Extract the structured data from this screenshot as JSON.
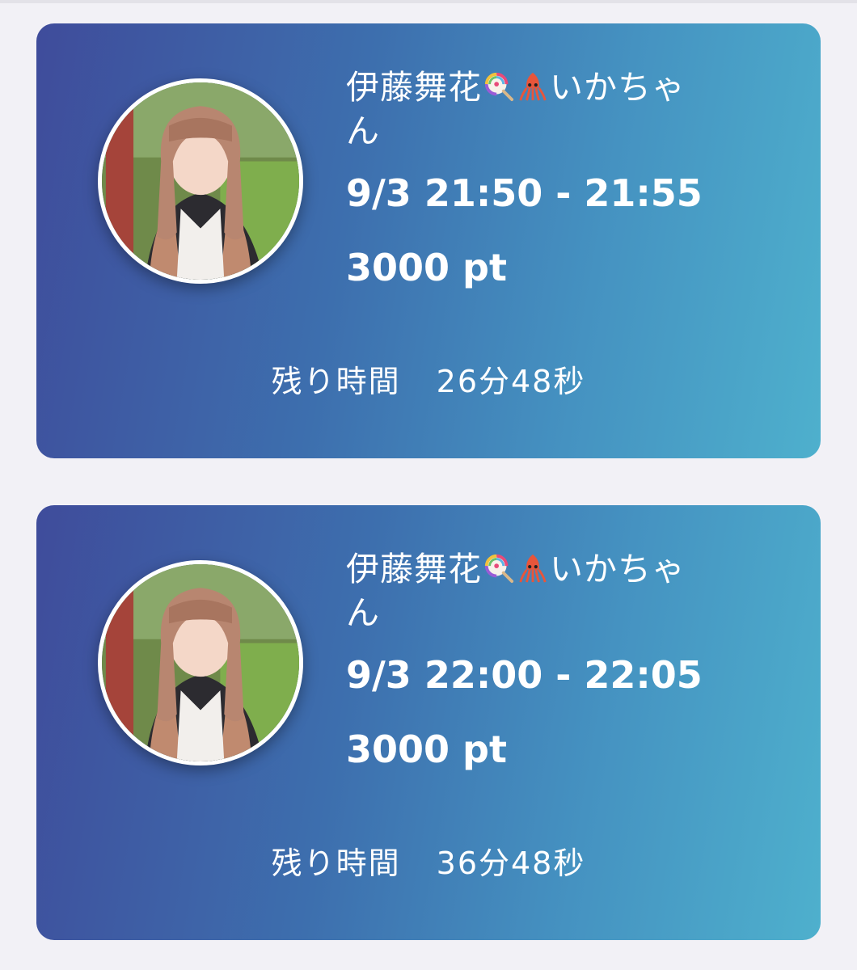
{
  "cards": [
    {
      "name_prefix": "伊藤舞花",
      "name_suffix": "いかちゃん",
      "emoji_1": "lollipop-icon",
      "emoji_2": "squid-icon",
      "time_range": "9/3 21:50 - 21:55",
      "points": "3000 pt",
      "remaining_label": "残り時間",
      "remaining_value": "26分48秒"
    },
    {
      "name_prefix": "伊藤舞花",
      "name_suffix": "いかちゃん",
      "emoji_1": "lollipop-icon",
      "emoji_2": "squid-icon",
      "time_range": "9/3 22:00 - 22:05",
      "points": "3000 pt",
      "remaining_label": "残り時間",
      "remaining_value": "36分48秒"
    }
  ],
  "colors": {
    "background": "#f2f1f6",
    "card_gradient_start": "#3f4c9b",
    "card_gradient_end": "#4eb0cd",
    "text": "#ffffff"
  }
}
